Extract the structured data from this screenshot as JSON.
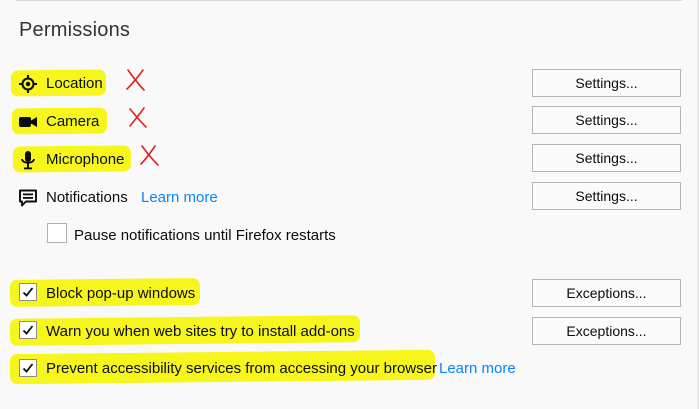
{
  "section_title": "Permissions",
  "permissions": [
    {
      "label": "Location",
      "icon": "location-icon",
      "button": "Settings..."
    },
    {
      "label": "Camera",
      "icon": "camera-icon",
      "button": "Settings..."
    },
    {
      "label": "Microphone",
      "icon": "microphone-icon",
      "button": "Settings..."
    },
    {
      "label": "Notifications",
      "icon": "notifications-icon",
      "link": "Learn more",
      "button": "Settings..."
    }
  ],
  "pause_notifications": {
    "label": "Pause notifications until Firefox restarts",
    "checked": false
  },
  "block_popups": {
    "label": "Block pop-up windows",
    "checked": true,
    "button": "Exceptions..."
  },
  "warn_addons": {
    "label": "Warn you when web sites try to install add-ons",
    "checked": true,
    "button": "Exceptions..."
  },
  "prevent_accessibility": {
    "label": "Prevent accessibility services from accessing your browser",
    "checked": true,
    "link": "Learn more"
  },
  "annotation": {
    "highlight_color": "#f5f50a",
    "cross_color": "#e32020",
    "cross_mark_icon": "red-cross-mark"
  },
  "colors": {
    "background": "#f9f9fa",
    "link": "#0a84ff",
    "checkmark": "#0c0c0d"
  }
}
